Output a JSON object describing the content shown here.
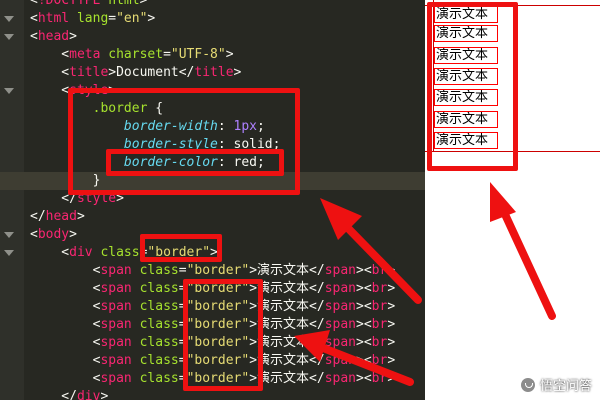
{
  "editor": {
    "theme_colors": {
      "background": "#272822",
      "tag": "#f92672",
      "attribute": "#a6e22e",
      "string": "#e6db74",
      "property": "#66d9ef",
      "number": "#ae81ff"
    },
    "lines": [
      [
        {
          "t": "punct",
          "v": "<"
        },
        {
          "t": "tag",
          "v": "!DOCTYPE"
        },
        {
          "t": "punct",
          "v": " "
        },
        {
          "t": "attr",
          "v": "html"
        },
        {
          "t": "punct",
          "v": ">"
        }
      ],
      [
        {
          "t": "punct",
          "v": "<"
        },
        {
          "t": "tag",
          "v": "html"
        },
        {
          "t": "punct",
          "v": " "
        },
        {
          "t": "attr",
          "v": "lang"
        },
        {
          "t": "punct",
          "v": "="
        },
        {
          "t": "str",
          "v": "\"en\""
        },
        {
          "t": "punct",
          "v": ">"
        }
      ],
      [
        {
          "t": "punct",
          "v": "<"
        },
        {
          "t": "tag",
          "v": "head"
        },
        {
          "t": "punct",
          "v": ">"
        }
      ],
      [
        {
          "t": "punct",
          "v": "    <"
        },
        {
          "t": "tag",
          "v": "meta"
        },
        {
          "t": "punct",
          "v": " "
        },
        {
          "t": "attr",
          "v": "charset"
        },
        {
          "t": "punct",
          "v": "="
        },
        {
          "t": "str",
          "v": "\"UTF-8\""
        },
        {
          "t": "punct",
          "v": ">"
        }
      ],
      [
        {
          "t": "punct",
          "v": "    <"
        },
        {
          "t": "tag",
          "v": "title"
        },
        {
          "t": "punct",
          "v": ">"
        },
        {
          "t": "text",
          "v": "Document"
        },
        {
          "t": "punct",
          "v": "</"
        },
        {
          "t": "tag",
          "v": "title"
        },
        {
          "t": "punct",
          "v": ">"
        }
      ],
      [
        {
          "t": "punct",
          "v": "    <"
        },
        {
          "t": "tag",
          "v": "style"
        },
        {
          "t": "punct",
          "v": ">"
        }
      ],
      [
        {
          "t": "punct",
          "v": "        "
        },
        {
          "t": "sel",
          "v": ".border"
        },
        {
          "t": "punct",
          "v": " {"
        }
      ],
      [
        {
          "t": "punct",
          "v": "            "
        },
        {
          "t": "prop",
          "v": "border-width"
        },
        {
          "t": "punct",
          "v": ": "
        },
        {
          "t": "num",
          "v": "1px"
        },
        {
          "t": "punct",
          "v": ";"
        }
      ],
      [
        {
          "t": "punct",
          "v": "            "
        },
        {
          "t": "prop",
          "v": "border-style"
        },
        {
          "t": "punct",
          "v": ": "
        },
        {
          "t": "kw",
          "v": "solid"
        },
        {
          "t": "punct",
          "v": ";"
        }
      ],
      [
        {
          "t": "punct",
          "v": "            "
        },
        {
          "t": "prop",
          "v": "border-color"
        },
        {
          "t": "punct",
          "v": ": "
        },
        {
          "t": "kw",
          "v": "red"
        },
        {
          "t": "punct",
          "v": ";"
        }
      ],
      [
        {
          "t": "punct",
          "v": "        }"
        }
      ],
      [
        {
          "t": "punct",
          "v": "    </"
        },
        {
          "t": "tag",
          "v": "style"
        },
        {
          "t": "punct",
          "v": ">"
        }
      ],
      [
        {
          "t": "punct",
          "v": "</"
        },
        {
          "t": "tag",
          "v": "head"
        },
        {
          "t": "punct",
          "v": ">"
        }
      ],
      [
        {
          "t": "punct",
          "v": "<"
        },
        {
          "t": "tag",
          "v": "body"
        },
        {
          "t": "punct",
          "v": ">"
        }
      ],
      [
        {
          "t": "punct",
          "v": "    <"
        },
        {
          "t": "tag",
          "v": "div"
        },
        {
          "t": "punct",
          "v": " "
        },
        {
          "t": "attr",
          "v": "class"
        },
        {
          "t": "punct",
          "v": "="
        },
        {
          "t": "str",
          "v": "\"border\""
        },
        {
          "t": "punct",
          "v": ">"
        }
      ],
      [
        {
          "t": "punct",
          "v": "        <"
        },
        {
          "t": "tag",
          "v": "span"
        },
        {
          "t": "punct",
          "v": " "
        },
        {
          "t": "attr",
          "v": "class"
        },
        {
          "t": "punct",
          "v": "="
        },
        {
          "t": "str",
          "v": "\"border\""
        },
        {
          "t": "punct",
          "v": ">"
        },
        {
          "t": "text",
          "v": "演示文本"
        },
        {
          "t": "punct",
          "v": "</"
        },
        {
          "t": "tag",
          "v": "span"
        },
        {
          "t": "punct",
          "v": "><"
        },
        {
          "t": "tag",
          "v": "br"
        },
        {
          "t": "punct",
          "v": ">"
        }
      ],
      [
        {
          "t": "punct",
          "v": "        <"
        },
        {
          "t": "tag",
          "v": "span"
        },
        {
          "t": "punct",
          "v": " "
        },
        {
          "t": "attr",
          "v": "class"
        },
        {
          "t": "punct",
          "v": "="
        },
        {
          "t": "str",
          "v": "\"border\""
        },
        {
          "t": "punct",
          "v": ">"
        },
        {
          "t": "text",
          "v": "演示文本"
        },
        {
          "t": "punct",
          "v": "</"
        },
        {
          "t": "tag",
          "v": "span"
        },
        {
          "t": "punct",
          "v": "><"
        },
        {
          "t": "tag",
          "v": "br"
        },
        {
          "t": "punct",
          "v": ">"
        }
      ],
      [
        {
          "t": "punct",
          "v": "        <"
        },
        {
          "t": "tag",
          "v": "span"
        },
        {
          "t": "punct",
          "v": " "
        },
        {
          "t": "attr",
          "v": "class"
        },
        {
          "t": "punct",
          "v": "="
        },
        {
          "t": "str",
          "v": "\"border\""
        },
        {
          "t": "punct",
          "v": ">"
        },
        {
          "t": "text",
          "v": "演示文本"
        },
        {
          "t": "punct",
          "v": "</"
        },
        {
          "t": "tag",
          "v": "span"
        },
        {
          "t": "punct",
          "v": "><"
        },
        {
          "t": "tag",
          "v": "br"
        },
        {
          "t": "punct",
          "v": ">"
        }
      ],
      [
        {
          "t": "punct",
          "v": "        <"
        },
        {
          "t": "tag",
          "v": "span"
        },
        {
          "t": "punct",
          "v": " "
        },
        {
          "t": "attr",
          "v": "class"
        },
        {
          "t": "punct",
          "v": "="
        },
        {
          "t": "str",
          "v": "\"border\""
        },
        {
          "t": "punct",
          "v": ">"
        },
        {
          "t": "text",
          "v": "演示文本"
        },
        {
          "t": "punct",
          "v": "</"
        },
        {
          "t": "tag",
          "v": "span"
        },
        {
          "t": "punct",
          "v": "><"
        },
        {
          "t": "tag",
          "v": "br"
        },
        {
          "t": "punct",
          "v": ">"
        }
      ],
      [
        {
          "t": "punct",
          "v": "        <"
        },
        {
          "t": "tag",
          "v": "span"
        },
        {
          "t": "punct",
          "v": " "
        },
        {
          "t": "attr",
          "v": "class"
        },
        {
          "t": "punct",
          "v": "="
        },
        {
          "t": "str",
          "v": "\"border\""
        },
        {
          "t": "punct",
          "v": ">"
        },
        {
          "t": "text",
          "v": "演示文本"
        },
        {
          "t": "punct",
          "v": "</"
        },
        {
          "t": "tag",
          "v": "span"
        },
        {
          "t": "punct",
          "v": "><"
        },
        {
          "t": "tag",
          "v": "br"
        },
        {
          "t": "punct",
          "v": ">"
        }
      ],
      [
        {
          "t": "punct",
          "v": "        <"
        },
        {
          "t": "tag",
          "v": "span"
        },
        {
          "t": "punct",
          "v": " "
        },
        {
          "t": "attr",
          "v": "class"
        },
        {
          "t": "punct",
          "v": "="
        },
        {
          "t": "str",
          "v": "\"border\""
        },
        {
          "t": "punct",
          "v": ">"
        },
        {
          "t": "text",
          "v": "演示文本"
        },
        {
          "t": "punct",
          "v": "</"
        },
        {
          "t": "tag",
          "v": "span"
        },
        {
          "t": "punct",
          "v": "><"
        },
        {
          "t": "tag",
          "v": "br"
        },
        {
          "t": "punct",
          "v": ">"
        }
      ],
      [
        {
          "t": "punct",
          "v": "        <"
        },
        {
          "t": "tag",
          "v": "span"
        },
        {
          "t": "punct",
          "v": " "
        },
        {
          "t": "attr",
          "v": "class"
        },
        {
          "t": "punct",
          "v": "="
        },
        {
          "t": "str",
          "v": "\"border\""
        },
        {
          "t": "punct",
          "v": ">"
        },
        {
          "t": "text",
          "v": "演示文本"
        },
        {
          "t": "punct",
          "v": "</"
        },
        {
          "t": "tag",
          "v": "span"
        },
        {
          "t": "punct",
          "v": "><"
        },
        {
          "t": "tag",
          "v": "br"
        },
        {
          "t": "punct",
          "v": ">"
        }
      ],
      [
        {
          "t": "punct",
          "v": "    </"
        },
        {
          "t": "tag",
          "v": "div"
        },
        {
          "t": "punct",
          "v": ">"
        }
      ]
    ]
  },
  "preview": {
    "span_text": [
      "演示文本",
      "演示文本",
      "演示文本",
      "演示文本",
      "演示文本",
      "演示文本",
      "演示文本"
    ],
    "border_color": "#ff0000"
  },
  "annotation_color": "#ee1111",
  "watermark": {
    "text": "悟空问答"
  }
}
